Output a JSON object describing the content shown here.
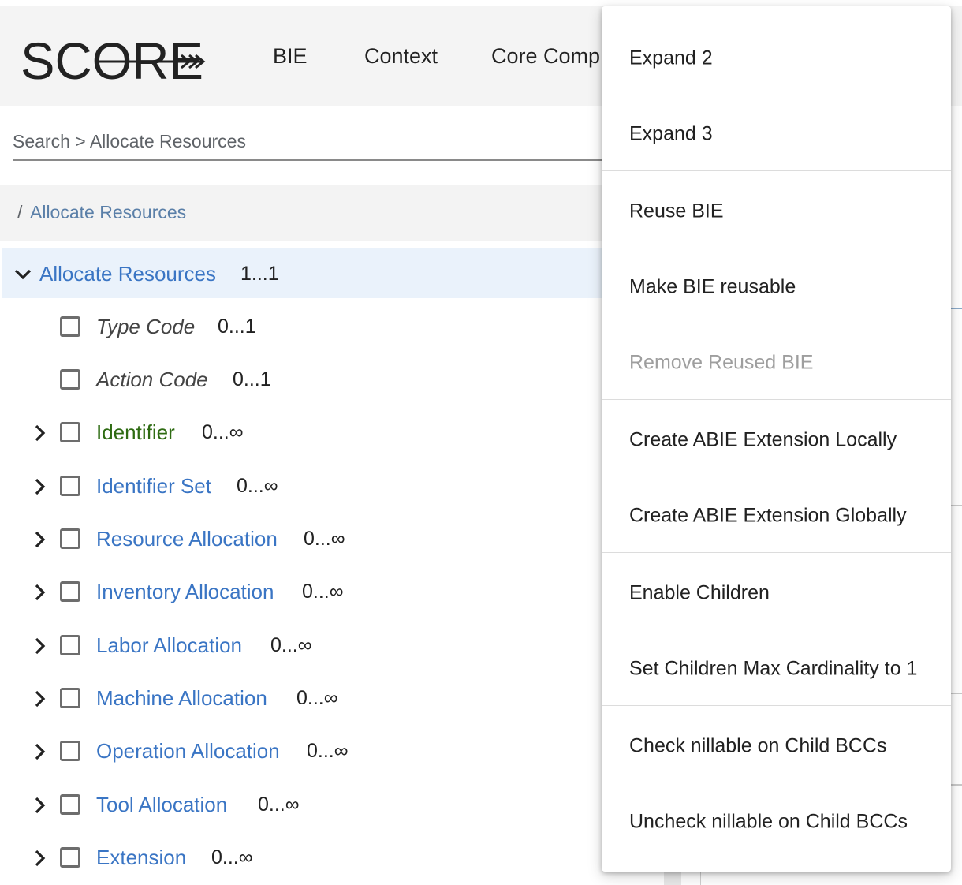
{
  "header": {
    "logo_text": "SCORE",
    "nav": [
      "BIE",
      "Context",
      "Core Comp"
    ]
  },
  "breadcrumb": "Search > Allocate Resources",
  "path": {
    "slash": "/",
    "link": "Allocate Resources"
  },
  "tree": {
    "root": {
      "label": "Allocate Resources",
      "cardinality": "1...1"
    },
    "children": [
      {
        "label": "Type Code",
        "cardinality": "0...1"
      },
      {
        "label": "Action Code",
        "cardinality": "0...1"
      },
      {
        "label": "Identifier",
        "cardinality": "0...∞"
      },
      {
        "label": "Identifier Set",
        "cardinality": "0...∞"
      },
      {
        "label": "Resource Allocation",
        "cardinality": "0...∞"
      },
      {
        "label": "Inventory Allocation",
        "cardinality": "0...∞"
      },
      {
        "label": "Labor Allocation",
        "cardinality": "0...∞"
      },
      {
        "label": "Machine Allocation",
        "cardinality": "0...∞"
      },
      {
        "label": "Operation Allocation",
        "cardinality": "0...∞"
      },
      {
        "label": "Tool Allocation",
        "cardinality": "0...∞"
      },
      {
        "label": "Extension",
        "cardinality": "0...∞"
      }
    ]
  },
  "context_menu": {
    "items": [
      "Expand 2",
      "Expand 3",
      "Reuse BIE",
      "Make BIE reusable",
      "Remove Reused BIE",
      "Create ABIE Extension Locally",
      "Create ABIE Extension Globally",
      "Enable Children",
      "Set Children Max Cardinality to 1",
      "Check nillable on Child BCCs",
      "Uncheck nillable on Child BCCs"
    ],
    "disabled_item": "Remove Reused BIE"
  },
  "colors": {
    "link": "#3a75c4",
    "link_muted": "#5a7fa8",
    "required_green": "#2e6b12",
    "root_highlight": "#eaf2fb",
    "header_bg": "#f4f4f4"
  }
}
